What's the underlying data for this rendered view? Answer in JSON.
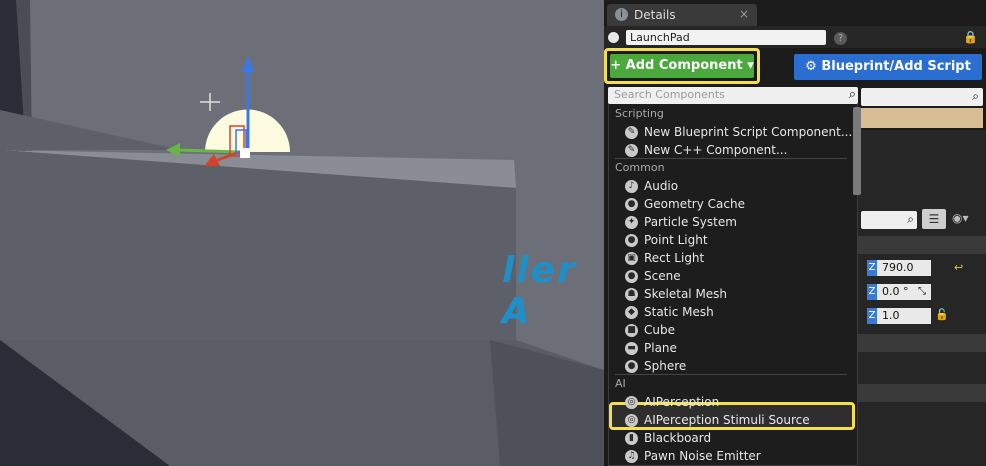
{
  "viewport": {
    "overlay_text": "ller A"
  },
  "details": {
    "tab_label": "Details",
    "tab_close": "×",
    "actor_name": "LaunchPad",
    "help": "?",
    "add_component_label": "+ Add Component ▾",
    "blueprint_label": "⚙ Blueprint/Add Script",
    "search_placeholder": "Search Components",
    "z_values": [
      "790.0",
      "0.0 °",
      "1.0"
    ],
    "z_label": "Z"
  },
  "menu": {
    "sections": [
      {
        "title": "Scripting",
        "items": [
          {
            "label": "New Blueprint Script Component...",
            "icon": "blueprint-icon"
          },
          {
            "label": "New C++ Component...",
            "icon": "cpp-icon"
          }
        ]
      },
      {
        "title": "Common",
        "items": [
          {
            "label": "Audio",
            "icon": "audio-icon"
          },
          {
            "label": "Geometry Cache",
            "icon": "geometry-cache-icon"
          },
          {
            "label": "Particle System",
            "icon": "particle-icon"
          },
          {
            "label": "Point Light",
            "icon": "point-light-icon"
          },
          {
            "label": "Rect Light",
            "icon": "rect-light-icon"
          },
          {
            "label": "Scene",
            "icon": "scene-icon"
          },
          {
            "label": "Skeletal Mesh",
            "icon": "skeletal-mesh-icon"
          },
          {
            "label": "Static Mesh",
            "icon": "static-mesh-icon"
          },
          {
            "label": "Cube",
            "icon": "cube-icon",
            "highlighted": true
          },
          {
            "label": "Plane",
            "icon": "plane-icon"
          },
          {
            "label": "Sphere",
            "icon": "sphere-icon"
          }
        ]
      },
      {
        "title": "AI",
        "items": [
          {
            "label": "AIPerception",
            "icon": "ai-perception-icon"
          },
          {
            "label": "AIPerception Stimuli Source",
            "icon": "stimuli-icon"
          },
          {
            "label": "Blackboard",
            "icon": "blackboard-icon"
          },
          {
            "label": "Pawn Noise Emitter",
            "icon": "noise-icon"
          }
        ]
      }
    ]
  },
  "colors": {
    "highlight": "#f4e04f",
    "add_button": "#4ba83d",
    "blueprint_button": "#2a6ed1"
  }
}
